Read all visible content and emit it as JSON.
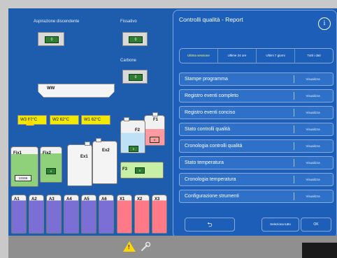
{
  "instrument": {
    "aspiration_label": "Aspirazione discendente",
    "aspiration_filter": "0",
    "fixative_label": "Fissativo",
    "fixative_filter": "0",
    "carbon_label": "Carbone",
    "carbon_filter": "0",
    "wax_bath_label": "WW",
    "wax_stations": [
      {
        "label": "W3 62°C"
      },
      {
        "label": "W2 62°C"
      },
      {
        "label": "W1 62°C"
      }
    ],
    "flask_f1": "F1",
    "flask_f1_tag": "0",
    "flask_f2": "F2",
    "flask_f2_tag": "0",
    "flask_f3": "F3",
    "flask_f3_tag": "0",
    "fix1": "Fix1",
    "fix1_counter": "13156",
    "fix2": "Fix2",
    "fix2_tag": "0",
    "ex1": "Ex1",
    "ex2": "Ex2",
    "reagents": [
      "A1",
      "A2",
      "A3",
      "A4",
      "A5",
      "A6",
      "X1",
      "X2",
      "X3"
    ]
  },
  "colors": {
    "screen_bg": "#1e5cae",
    "alcohol_bottle": "#7b6fd6",
    "xylene_bottle": "#ff7a86",
    "fixative_bottle": "#8fd17a",
    "yellow_lcd": "#f3e800",
    "warning": "#ffd400"
  },
  "panel": {
    "title": "Controlli qualità - Report",
    "info_icon": "i",
    "tabs": [
      "Ultima sessione",
      "Ultime 24 ore",
      "Ultimi 7 giorni",
      "Tutti i dati"
    ],
    "selected_tab": "Ultima sessione",
    "rows": [
      {
        "label": "Stampe programma",
        "action": "Visualizza"
      },
      {
        "label": "Registro eventi completo",
        "action": "Visualizza"
      },
      {
        "label": "Registro eventi conciso",
        "action": "Visualizza"
      },
      {
        "label": "Stato controlli qualità",
        "action": "Visualizza"
      },
      {
        "label": "Cronologia controlli qualità",
        "action": "Visualizza"
      },
      {
        "label": "Stato temperatura",
        "action": "Visualizza"
      },
      {
        "label": "Cronologia temperatura",
        "action": "Visualizza"
      },
      {
        "label": "Configurazione strumenti",
        "action": "Visualizza"
      }
    ],
    "back_icon": "⮌",
    "select_all": "Seleziona tutto",
    "ok": "OK"
  },
  "status_bar": {
    "warning_icon": "warning-icon",
    "wrench_icon": "wrench-icon"
  }
}
